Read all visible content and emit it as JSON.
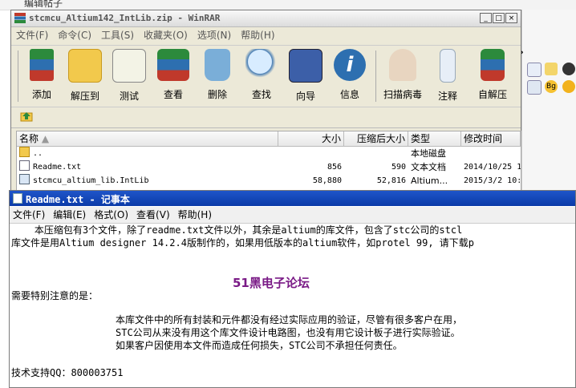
{
  "host": {
    "edit_tab": "编辑帖子",
    "chevron": "»"
  },
  "winrar": {
    "title": "stcmcu_Altium142_IntLib.zip - WinRAR",
    "controls": {
      "min": "_",
      "max": "□",
      "close": "×"
    },
    "menu": [
      "文件(F)",
      "命令(C)",
      "工具(S)",
      "收藏夹(O)",
      "选项(N)",
      "帮助(H)"
    ],
    "toolbar": [
      "添加",
      "解压到",
      "测试",
      "查看",
      "删除",
      "查找",
      "向导",
      "信息",
      "扫描病毒",
      "注释",
      "自解压"
    ],
    "columns": {
      "name": "名称",
      "size": "大小",
      "packed": "压缩后大小",
      "type": "类型",
      "modified": "修改时间"
    },
    "files": [
      {
        "name": "..",
        "size": "",
        "packed": "",
        "type": "本地磁盘",
        "modified": ""
      },
      {
        "name": "Readme.txt",
        "size": "856",
        "packed": "590",
        "type": "文本文档",
        "modified": "2014/10/25 1"
      },
      {
        "name": "stcmcu_altium_lib.IntLib",
        "size": "58,880",
        "packed": "52,816",
        "type": "Altium...",
        "modified": "2015/3/2 10:"
      }
    ]
  },
  "notepad": {
    "title": "Readme.txt - 记事本",
    "menu": [
      "文件(F)",
      "编辑(E)",
      "格式(O)",
      "查看(V)",
      "帮助(H)"
    ],
    "lines": [
      "    本压缩包有3个文件，除了readme.txt文件以外，其余是altium的库文件，包含了stc公司的stcl",
      "库文件是用Altium designer 14.2.4版制作的，如果用低版本的altium软件，如protel 99, 请下载p",
      "需要特别注意的是：",
      "本库文件中的所有封装和元件都没有经过实际应用的验证，尽管有很多客户在用，",
      "STC公司从来没有用这个库文件设计电路图，也没有用它设计板子进行实际验证。",
      "如果客户因使用本文件而造成任何损失，STC公司不承担任何责任。",
      "技术支持QQ：800003751"
    ],
    "watermark": "51黑电子论坛"
  },
  "colors": {
    "notepad_title": "#0a3aa8",
    "watermark": "#7a1a86"
  }
}
